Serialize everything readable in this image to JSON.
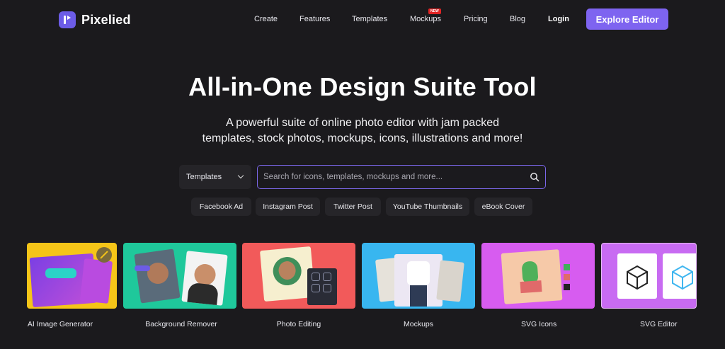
{
  "brand": {
    "name": "Pixelied"
  },
  "nav": {
    "links": [
      "Create",
      "Features",
      "Templates",
      "Mockups",
      "Pricing",
      "Blog"
    ],
    "new_badge": "NEW",
    "login": "Login",
    "cta": "Explore Editor"
  },
  "hero": {
    "title": "All-in-One Design Suite Tool",
    "subtitle_line1": "A powerful suite of online photo editor with jam packed",
    "subtitle_line2": "templates, stock photos, mockups, icons, illustrations and more!"
  },
  "search": {
    "category": "Templates",
    "placeholder": "Search for icons, templates, mockups and more..."
  },
  "tags": [
    "Facebook Ad",
    "Instagram Post",
    "Twitter Post",
    "YouTube Thumbnails",
    "eBook Cover"
  ],
  "tools": [
    {
      "label": "AI Image Generator",
      "color": "#f5c518"
    },
    {
      "label": "Background Remover",
      "color": "#1fc89b"
    },
    {
      "label": "Photo Editing",
      "color": "#f25a5a"
    },
    {
      "label": "Mockups",
      "color": "#38b6f0"
    },
    {
      "label": "SVG Icons",
      "color": "#d75cf0"
    },
    {
      "label": "SVG Editor",
      "color": "#c86bf2"
    }
  ],
  "colors": {
    "background": "#1b1a1d",
    "accent": "#7e64f0",
    "badge": "#e02424"
  }
}
